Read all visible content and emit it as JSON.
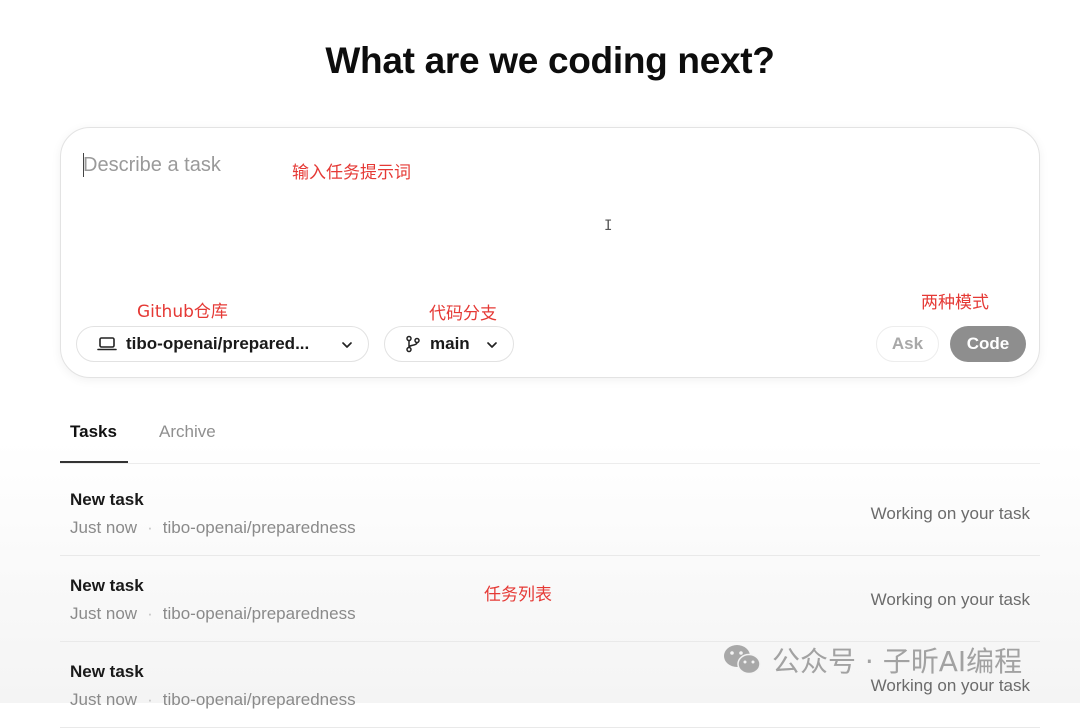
{
  "page": {
    "title": "What are we coding next?"
  },
  "composer": {
    "placeholder": "Describe a task",
    "repo_label": "tibo-openai/prepared...",
    "branch_label": "main",
    "ask_label": "Ask",
    "code_label": "Code"
  },
  "annotations": {
    "input": "输入任务提示词",
    "repo": "Github仓库",
    "branch": "代码分支",
    "modes": "两种模式",
    "list": "任务列表"
  },
  "tabs": [
    {
      "label": "Tasks",
      "active": true
    },
    {
      "label": "Archive",
      "active": false
    }
  ],
  "tasks": [
    {
      "title": "New task",
      "time": "Just now",
      "repo": "tibo-openai/preparedness",
      "status": "Working on your task"
    },
    {
      "title": "New task",
      "time": "Just now",
      "repo": "tibo-openai/preparedness",
      "status": "Working on your task"
    },
    {
      "title": "New task",
      "time": "Just now",
      "repo": "tibo-openai/preparedness",
      "status": "Working on your task"
    }
  ],
  "watermark": {
    "text": "公众号 · 子昕AI编程",
    "icon": "wechat-icon"
  },
  "colors": {
    "annotation": "#e53935",
    "code_button": "#8e8e8e",
    "accent_text": "#111111"
  }
}
